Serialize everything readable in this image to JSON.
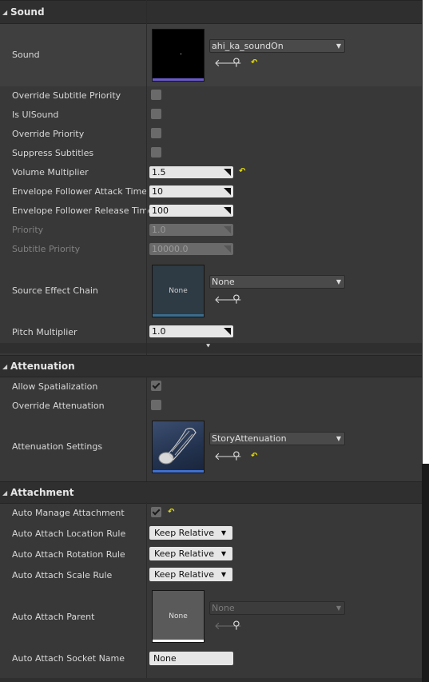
{
  "sections": {
    "sound": "Sound",
    "attenuation": "Attenuation",
    "attachment": "Attachment"
  },
  "sound": {
    "label": "Sound",
    "asset": "ahi_ka_soundOn",
    "override_subtitle_priority": {
      "label": "Override Subtitle Priority",
      "checked": false
    },
    "is_ui_sound": {
      "label": "Is UISound",
      "checked": false
    },
    "override_priority": {
      "label": "Override Priority",
      "checked": false
    },
    "suppress_subtitles": {
      "label": "Suppress Subtitles",
      "checked": false
    },
    "volume_multiplier": {
      "label": "Volume Multiplier",
      "value": "1.5"
    },
    "envelope_attack": {
      "label": "Envelope Follower Attack Time",
      "value": "10"
    },
    "envelope_release": {
      "label": "Envelope Follower Release Time",
      "value": "100"
    },
    "priority": {
      "label": "Priority",
      "value": "1.0"
    },
    "subtitle_priority": {
      "label": "Subtitle Priority",
      "value": "10000.0"
    },
    "source_effect_chain": {
      "label": "Source Effect Chain",
      "value": "None",
      "thumb": "None"
    },
    "pitch_multiplier": {
      "label": "Pitch Multiplier",
      "value": "1.0"
    }
  },
  "attenuation": {
    "allow_spatialization": {
      "label": "Allow Spatialization",
      "checked": true
    },
    "override_attenuation": {
      "label": "Override Attenuation",
      "checked": false
    },
    "settings": {
      "label": "Attenuation Settings",
      "value": "StoryAttenuation"
    }
  },
  "attachment": {
    "auto_manage": {
      "label": "Auto Manage Attachment",
      "checked": true
    },
    "location_rule": {
      "label": "Auto Attach Location Rule",
      "value": "Keep Relative"
    },
    "rotation_rule": {
      "label": "Auto Attach Rotation Rule",
      "value": "Keep Relative"
    },
    "scale_rule": {
      "label": "Auto Attach Scale Rule",
      "value": "Keep Relative"
    },
    "parent": {
      "label": "Auto Attach Parent",
      "value": "None",
      "thumb": "None"
    },
    "socket_name": {
      "label": "Auto Attach Socket Name",
      "value": "None"
    }
  },
  "icons": {
    "back": "arrow-left-icon",
    "browse": "search-icon",
    "reset": "reset-to-default-icon",
    "expand": "expand-advanced-icon"
  },
  "colors": {
    "background": "#383838",
    "section_header": "#2f2f2f",
    "input": "#e6e6e6",
    "reset": "#e8e000",
    "sound_bar": "#6a5acd",
    "effect_bar": "#3a6e8e",
    "attenuation_bar": "#3f6fd0"
  }
}
